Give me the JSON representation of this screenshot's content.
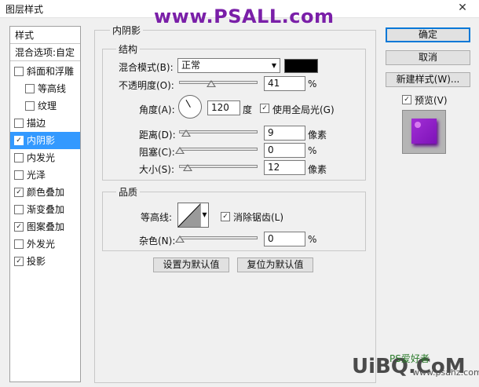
{
  "window": {
    "title": "图层样式",
    "close_glyph": "✕"
  },
  "watermark": "www.PSALL.com",
  "styles_panel": {
    "header": "样式",
    "blend_options": "混合选项:自定",
    "items": [
      {
        "label": "斜面和浮雕",
        "checked": false,
        "indent": false
      },
      {
        "label": "等高线",
        "checked": false,
        "indent": true
      },
      {
        "label": "纹理",
        "checked": false,
        "indent": true
      },
      {
        "label": "描边",
        "checked": false,
        "indent": false
      },
      {
        "label": "内阴影",
        "checked": true,
        "indent": false,
        "selected": true
      },
      {
        "label": "内发光",
        "checked": false,
        "indent": false
      },
      {
        "label": "光泽",
        "checked": false,
        "indent": false
      },
      {
        "label": "颜色叠加",
        "checked": true,
        "indent": false
      },
      {
        "label": "渐变叠加",
        "checked": false,
        "indent": false
      },
      {
        "label": "图案叠加",
        "checked": true,
        "indent": false
      },
      {
        "label": "外发光",
        "checked": false,
        "indent": false
      },
      {
        "label": "投影",
        "checked": true,
        "indent": false
      }
    ]
  },
  "inner_shadow": {
    "group_title": "内阴影",
    "structure": {
      "title": "结构",
      "blend_mode_label": "混合模式(B):",
      "blend_mode_value": "正常",
      "shadow_color": "#000000",
      "opacity_label": "不透明度(O):",
      "opacity_value": "41",
      "opacity_unit": "%",
      "angle_label": "角度(A):",
      "angle_value": "120",
      "angle_unit": "度",
      "global_light_label": "使用全局光(G)",
      "global_light_checked": true,
      "distance_label": "距离(D):",
      "distance_value": "9",
      "distance_unit": "像素",
      "choke_label": "阻塞(C):",
      "choke_value": "0",
      "choke_unit": "%",
      "size_label": "大小(S):",
      "size_value": "12",
      "size_unit": "像素"
    },
    "quality": {
      "title": "品质",
      "contour_label": "等高线:",
      "anti_alias_label": "消除锯齿(L)",
      "anti_alias_checked": true,
      "noise_label": "杂色(N):",
      "noise_value": "0",
      "noise_unit": "%"
    },
    "set_default": "设置为默认值",
    "reset_default": "复位为默认值"
  },
  "buttons": {
    "ok": "确定",
    "cancel": "取消",
    "new_style": "新建样式(W)..."
  },
  "preview": {
    "label": "预览(V)",
    "checked": true
  },
  "logo": {
    "main": "UiBQ.CoM",
    "sub": "PS爱好者",
    "url": "www.psahz.com"
  }
}
